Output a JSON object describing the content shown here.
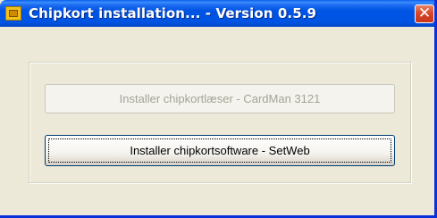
{
  "window": {
    "title": "Chipkort installation... - Version 0.5.9",
    "close_symbol": "✕",
    "icon": "chipcard-icon"
  },
  "buttons": {
    "cardreader_label": "Installer chipkortlæser - CardMan 3121",
    "cardreader_enabled": false,
    "software_label": "Installer chipkortsoftware - SetWeb",
    "software_enabled": true
  },
  "colors": {
    "titlebar": "#0054e3",
    "dialog_bg": "#ece9d8",
    "close_button": "#d9482a"
  }
}
